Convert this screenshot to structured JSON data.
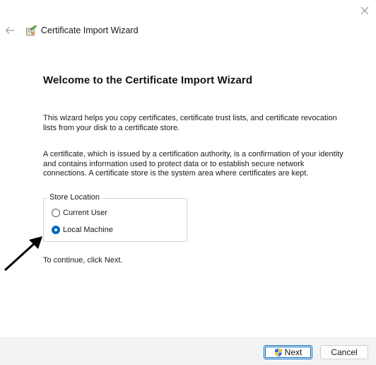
{
  "window": {
    "title": "Certificate Import Wizard"
  },
  "icons": {
    "close": "close-icon",
    "back": "back-arrow-icon",
    "wizard": "certificate-wizard-icon",
    "shield": "uac-shield-icon"
  },
  "main": {
    "heading": "Welcome to the Certificate Import Wizard",
    "paragraph1": "This wizard helps you copy certificates, certificate trust lists, and certificate revocation lists from your disk to a certificate store.",
    "paragraph2": "A certificate, which is issued by a certification authority, is a confirmation of your identity and contains information used to protect data or to establish secure network connections. A certificate store is the system area where certificates are kept.",
    "store_location": {
      "legend": "Store Location",
      "options": [
        {
          "label": "Current User",
          "selected": false
        },
        {
          "label": "Local Machine",
          "selected": true
        }
      ]
    },
    "continue_text": "To continue, click Next."
  },
  "footer": {
    "next_label": "Next",
    "cancel_label": "Cancel"
  },
  "colors": {
    "accent": "#0067c0",
    "footer_bg": "#f3f3f3"
  }
}
